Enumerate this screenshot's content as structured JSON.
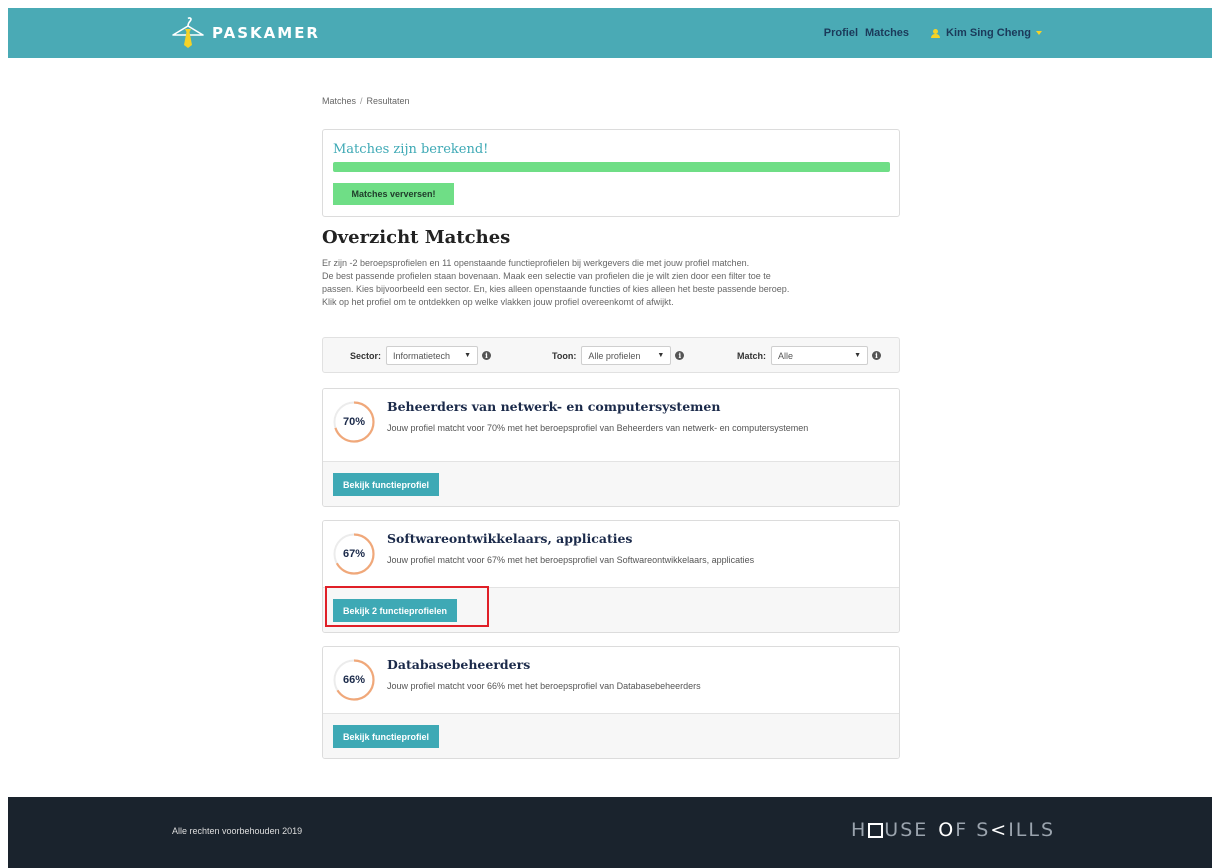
{
  "header": {
    "brand": "PASKAMER",
    "nav": [
      "Profiel",
      "Matches"
    ],
    "user": "Kim Sing Cheng"
  },
  "breadcrumb": {
    "parent": "Matches",
    "separator": "/",
    "current": "Resultaten"
  },
  "status": {
    "title": "Matches zijn berekend!",
    "progress_percent": 100,
    "button": "Matches verversen!"
  },
  "overview": {
    "title": "Overzicht Matches",
    "intro": [
      "Er zijn -2 beroepsprofielen en 11 openstaande functieprofielen bij werkgevers die met jouw profiel matchen.",
      "De best passende profielen staan bovenaan. Maak een selectie van profielen die je wilt zien door een filter toe te",
      "passen. Kies bijvoorbeeld een sector. En, kies alleen openstaande functies of kies alleen het beste passende beroep.",
      "Klik op het profiel om te ontdekken op welke vlakken jouw profiel overeenkomt of afwijkt."
    ]
  },
  "filters": {
    "sector": {
      "label": "Sector:",
      "value": "Informatietech"
    },
    "toon": {
      "label": "Toon:",
      "value": "Alle profielen"
    },
    "match": {
      "label": "Match:",
      "value": "Alle"
    },
    "info_glyph": "i"
  },
  "matches": [
    {
      "percent": 70,
      "percent_label": "70%",
      "title": "Beheerders van netwerk- en computersystemen",
      "description": "Jouw profiel matcht voor 70% met het beroepsprofiel van Beheerders van netwerk- en computersystemen",
      "button": "Bekijk functieprofiel"
    },
    {
      "percent": 67,
      "percent_label": "67%",
      "title": "Softwareontwikkelaars, applicaties",
      "description": "Jouw profiel matcht voor 67% met het beroepsprofiel van Softwareontwikkelaars, applicaties",
      "button": "Bekijk 2 functieprofielen"
    },
    {
      "percent": 66,
      "percent_label": "66%",
      "title": "Databasebeheerders",
      "description": "Jouw profiel matcht voor 66% met het beroepsprofiel van Databasebeheerders",
      "button": "Bekijk functieprofiel"
    }
  ],
  "footer": {
    "copyright": "Alle rechten voorbehouden 2019",
    "logo_parts": [
      "H",
      "USE",
      "O",
      "F S",
      "ILLS"
    ]
  },
  "colors": {
    "teal": "#4aaab5",
    "button_teal": "#3ea9b5",
    "green": "#6fde86",
    "yellow": "#f5d327",
    "footer": "#1a232d",
    "highlight": "#e01f27"
  }
}
